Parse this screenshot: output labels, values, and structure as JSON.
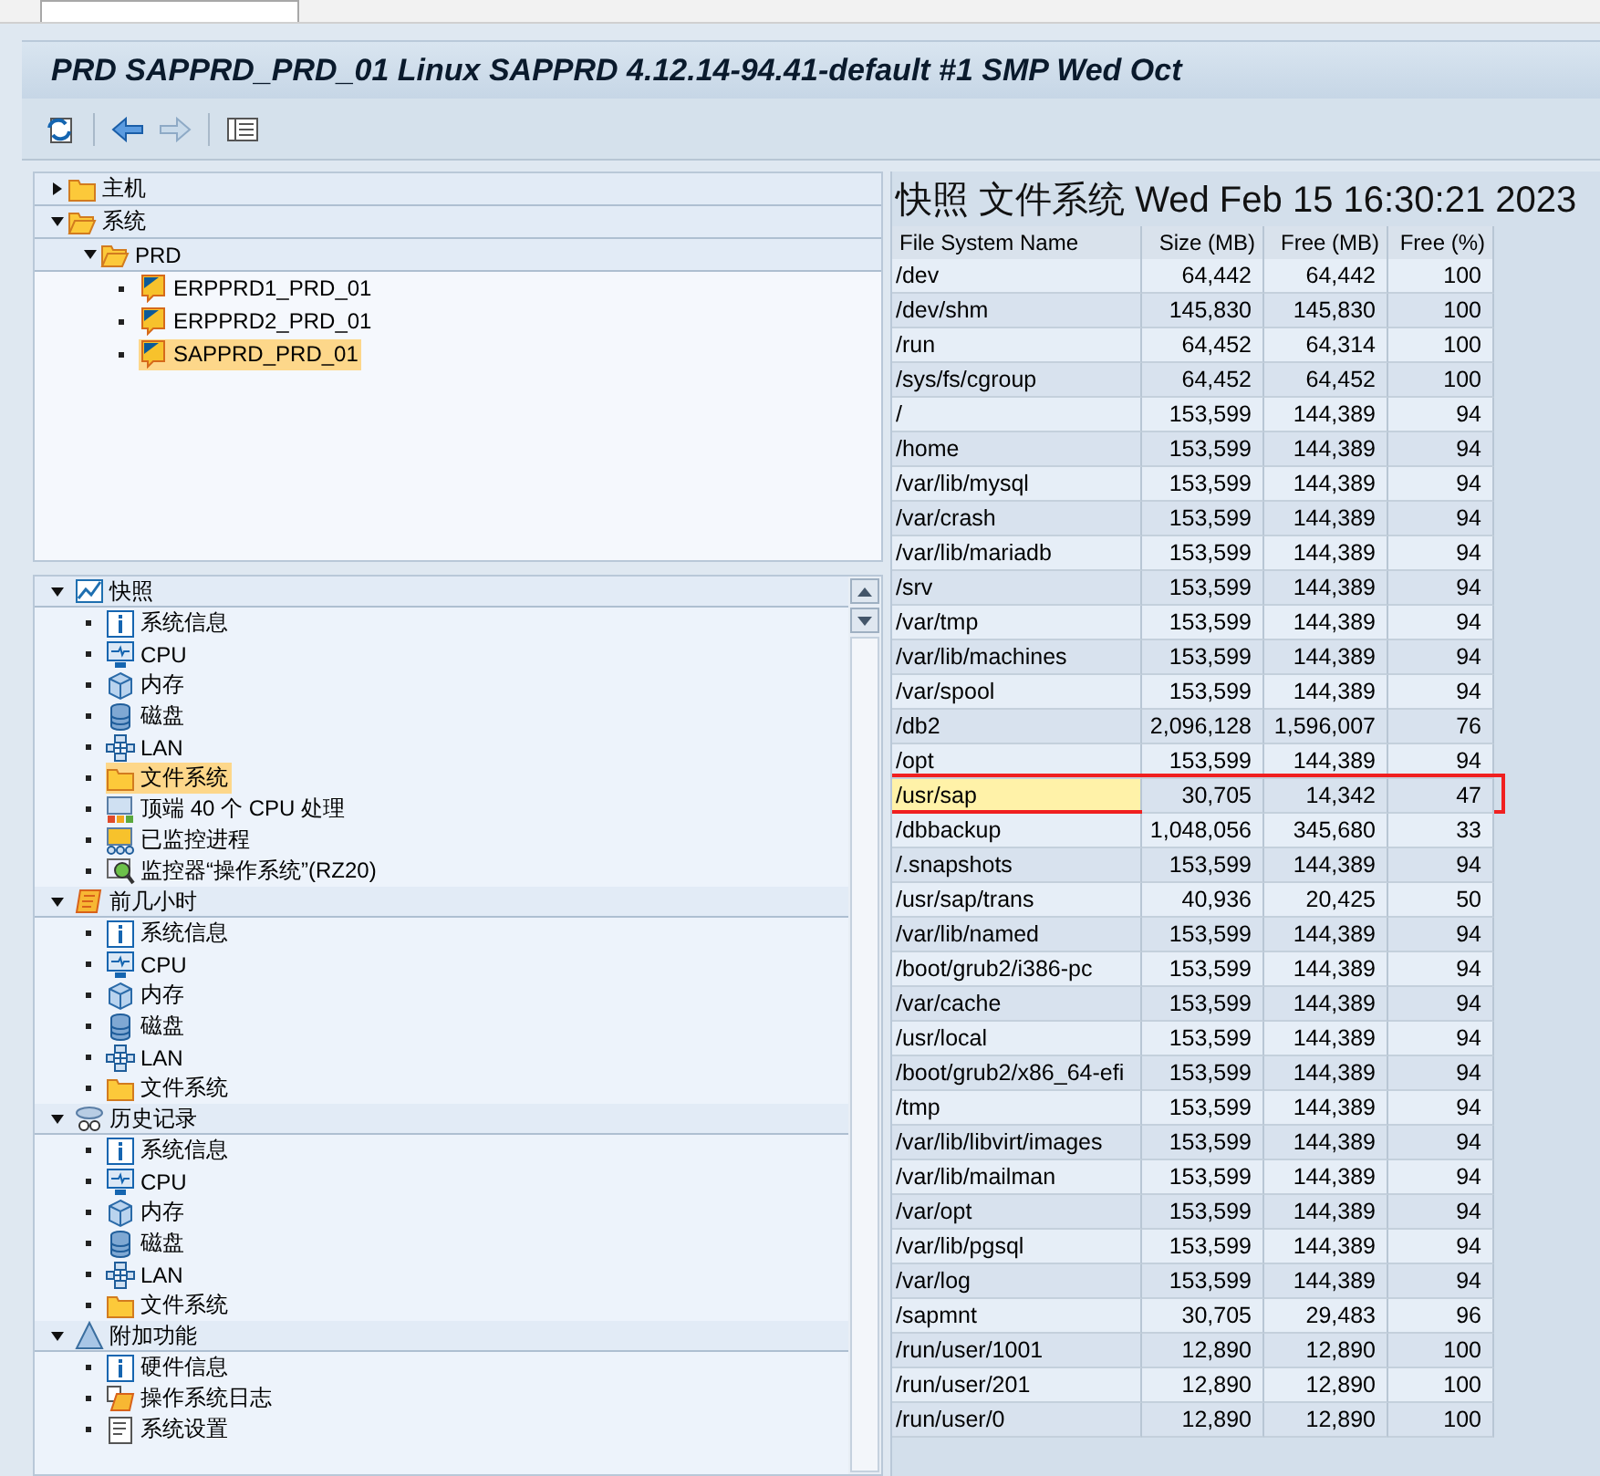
{
  "window": {
    "title": "PRD SAPPRD_PRD_01 Linux SAPPRD 4.12.14-94.41-default #1 SMP Wed Oct"
  },
  "toolbar": [
    {
      "kind": "refresh"
    },
    {
      "kind": "back"
    },
    {
      "kind": "forward"
    },
    {
      "kind": "layout"
    }
  ],
  "system_tree": [
    {
      "label": "主机",
      "kind": "folder",
      "expanded": false,
      "selected": false
    },
    {
      "label": "系统",
      "kind": "folder-open",
      "expanded": true,
      "selected": false,
      "children": [
        {
          "label": "PRD",
          "kind": "folder-open",
          "expanded": true,
          "selected": false,
          "children": [
            {
              "label": "ERPPRD1_PRD_01",
              "kind": "system",
              "selected": false
            },
            {
              "label": "ERPPRD2_PRD_01",
              "kind": "system",
              "selected": false
            },
            {
              "label": "SAPPRD_PRD_01",
              "kind": "system",
              "selected": true
            }
          ]
        }
      ]
    }
  ],
  "monitor_tree": [
    {
      "label": "快照",
      "kind": "chart",
      "expanded": true,
      "children": [
        {
          "label": "系统信息",
          "kind": "info",
          "selected": false
        },
        {
          "label": "CPU",
          "kind": "monitor",
          "selected": false
        },
        {
          "label": "内存",
          "kind": "cube",
          "selected": false
        },
        {
          "label": "磁盘",
          "kind": "disk",
          "selected": false
        },
        {
          "label": "LAN",
          "kind": "network",
          "selected": false
        },
        {
          "label": "文件系统",
          "kind": "folder",
          "selected": true
        },
        {
          "label": "顶端 40 个 CPU 处理",
          "kind": "processes",
          "selected": false
        },
        {
          "label": "已监控进程",
          "kind": "monitored",
          "selected": false
        },
        {
          "label": "监控器“操作系统”(RZ20)",
          "kind": "magnifier",
          "selected": false
        }
      ]
    },
    {
      "label": "前几小时",
      "kind": "scroll",
      "expanded": true,
      "children": [
        {
          "label": "系统信息",
          "kind": "info",
          "selected": false
        },
        {
          "label": "CPU",
          "kind": "monitor",
          "selected": false
        },
        {
          "label": "内存",
          "kind": "cube",
          "selected": false
        },
        {
          "label": "磁盘",
          "kind": "disk",
          "selected": false
        },
        {
          "label": "LAN",
          "kind": "network",
          "selected": false
        },
        {
          "label": "文件系统",
          "kind": "folder",
          "selected": false
        }
      ]
    },
    {
      "label": "历史记录",
      "kind": "glasses",
      "expanded": true,
      "children": [
        {
          "label": "系统信息",
          "kind": "info",
          "selected": false
        },
        {
          "label": "CPU",
          "kind": "monitor",
          "selected": false
        },
        {
          "label": "内存",
          "kind": "cube",
          "selected": false
        },
        {
          "label": "磁盘",
          "kind": "disk",
          "selected": false
        },
        {
          "label": "LAN",
          "kind": "network",
          "selected": false
        },
        {
          "label": "文件系统",
          "kind": "folder",
          "selected": false
        }
      ]
    },
    {
      "label": "附加功能",
      "kind": "triangle",
      "expanded": true,
      "children": [
        {
          "label": "硬件信息",
          "kind": "info",
          "selected": false
        },
        {
          "label": "操作系统日志",
          "kind": "log",
          "selected": false
        },
        {
          "label": "系统设置",
          "kind": "sheet",
          "selected": false
        }
      ]
    }
  ],
  "report": {
    "heading": "快照 文件系统 Wed Feb 15 16:30:21 2023",
    "columns": [
      "File System Name",
      "Size (MB)",
      "Free (MB)",
      "Free (%)"
    ],
    "rows": [
      {
        "cells": [
          "/dev",
          "64,442",
          "64,442",
          "100"
        ],
        "selected": false,
        "marked": false
      },
      {
        "cells": [
          "/dev/shm",
          "145,830",
          "145,830",
          "100"
        ],
        "selected": false,
        "marked": false
      },
      {
        "cells": [
          "/run",
          "64,452",
          "64,314",
          "100"
        ],
        "selected": false,
        "marked": false
      },
      {
        "cells": [
          "/sys/fs/cgroup",
          "64,452",
          "64,452",
          "100"
        ],
        "selected": false,
        "marked": false
      },
      {
        "cells": [
          "/",
          "153,599",
          "144,389",
          "94"
        ],
        "selected": false,
        "marked": false
      },
      {
        "cells": [
          "/home",
          "153,599",
          "144,389",
          "94"
        ],
        "selected": false,
        "marked": false
      },
      {
        "cells": [
          "/var/lib/mysql",
          "153,599",
          "144,389",
          "94"
        ],
        "selected": false,
        "marked": false
      },
      {
        "cells": [
          "/var/crash",
          "153,599",
          "144,389",
          "94"
        ],
        "selected": false,
        "marked": false
      },
      {
        "cells": [
          "/var/lib/mariadb",
          "153,599",
          "144,389",
          "94"
        ],
        "selected": false,
        "marked": false
      },
      {
        "cells": [
          "/srv",
          "153,599",
          "144,389",
          "94"
        ],
        "selected": false,
        "marked": false
      },
      {
        "cells": [
          "/var/tmp",
          "153,599",
          "144,389",
          "94"
        ],
        "selected": false,
        "marked": false
      },
      {
        "cells": [
          "/var/lib/machines",
          "153,599",
          "144,389",
          "94"
        ],
        "selected": false,
        "marked": false
      },
      {
        "cells": [
          "/var/spool",
          "153,599",
          "144,389",
          "94"
        ],
        "selected": false,
        "marked": false
      },
      {
        "cells": [
          "/db2",
          "2,096,128",
          "1,596,007",
          "76"
        ],
        "selected": false,
        "marked": false
      },
      {
        "cells": [
          "/opt",
          "153,599",
          "144,389",
          "94"
        ],
        "selected": false,
        "marked": false
      },
      {
        "cells": [
          "/usr/sap",
          "30,705",
          "14,342",
          "47"
        ],
        "selected": true,
        "marked": true
      },
      {
        "cells": [
          "/dbbackup",
          "1,048,056",
          "345,680",
          "33"
        ],
        "selected": false,
        "marked": false
      },
      {
        "cells": [
          "/.snapshots",
          "153,599",
          "144,389",
          "94"
        ],
        "selected": false,
        "marked": false
      },
      {
        "cells": [
          "/usr/sap/trans",
          "40,936",
          "20,425",
          "50"
        ],
        "selected": false,
        "marked": false
      },
      {
        "cells": [
          "/var/lib/named",
          "153,599",
          "144,389",
          "94"
        ],
        "selected": false,
        "marked": false
      },
      {
        "cells": [
          "/boot/grub2/i386-pc",
          "153,599",
          "144,389",
          "94"
        ],
        "selected": false,
        "marked": false
      },
      {
        "cells": [
          "/var/cache",
          "153,599",
          "144,389",
          "94"
        ],
        "selected": false,
        "marked": false
      },
      {
        "cells": [
          "/usr/local",
          "153,599",
          "144,389",
          "94"
        ],
        "selected": false,
        "marked": false
      },
      {
        "cells": [
          "/boot/grub2/x86_64-efi",
          "153,599",
          "144,389",
          "94"
        ],
        "selected": false,
        "marked": false
      },
      {
        "cells": [
          "/tmp",
          "153,599",
          "144,389",
          "94"
        ],
        "selected": false,
        "marked": false
      },
      {
        "cells": [
          "/var/lib/libvirt/images",
          "153,599",
          "144,389",
          "94"
        ],
        "selected": false,
        "marked": false
      },
      {
        "cells": [
          "/var/lib/mailman",
          "153,599",
          "144,389",
          "94"
        ],
        "selected": false,
        "marked": false
      },
      {
        "cells": [
          "/var/opt",
          "153,599",
          "144,389",
          "94"
        ],
        "selected": false,
        "marked": false
      },
      {
        "cells": [
          "/var/lib/pgsql",
          "153,599",
          "144,389",
          "94"
        ],
        "selected": false,
        "marked": false
      },
      {
        "cells": [
          "/var/log",
          "153,599",
          "144,389",
          "94"
        ],
        "selected": false,
        "marked": false
      },
      {
        "cells": [
          "/sapmnt",
          "30,705",
          "29,483",
          "96"
        ],
        "selected": false,
        "marked": false
      },
      {
        "cells": [
          "/run/user/1001",
          "12,890",
          "12,890",
          "100"
        ],
        "selected": false,
        "marked": false
      },
      {
        "cells": [
          "/run/user/201",
          "12,890",
          "12,890",
          "100"
        ],
        "selected": false,
        "marked": false
      },
      {
        "cells": [
          "/run/user/0",
          "12,890",
          "12,890",
          "100"
        ],
        "selected": false,
        "marked": false
      }
    ]
  }
}
